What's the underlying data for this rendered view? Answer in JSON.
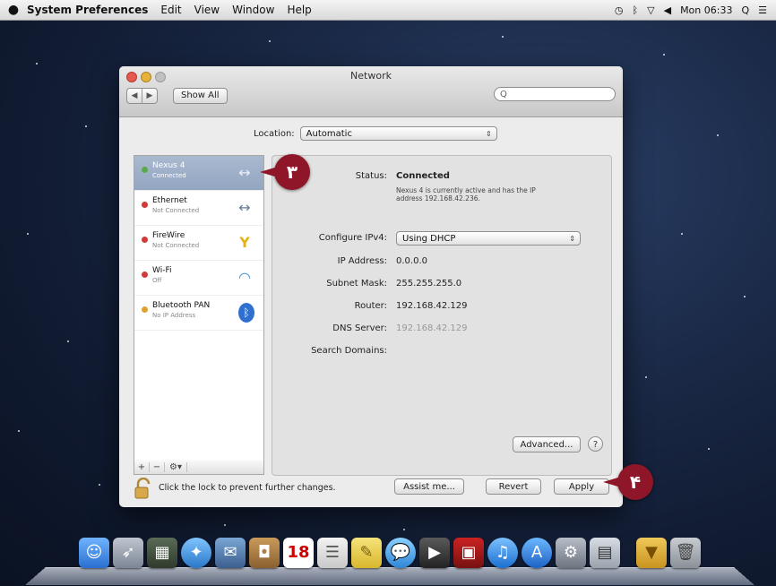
{
  "menubar": {
    "apple": "",
    "app_name": "System Preferences",
    "items": [
      "Edit",
      "View",
      "Window",
      "Help"
    ],
    "clock": "Mon 06:33"
  },
  "window": {
    "title": "Network",
    "nav_back": "◀",
    "nav_forward": "▶",
    "show_all": "Show All",
    "search_placeholder": "Q"
  },
  "location": {
    "label": "Location:",
    "value": "Automatic"
  },
  "services": [
    {
      "name": "Nexus 4",
      "status": "Connected",
      "dot": "#5aaa4a",
      "icon": "↔"
    },
    {
      "name": "Ethernet",
      "status": "Not Connected",
      "dot": "#d03a3a",
      "icon": "↔"
    },
    {
      "name": "FireWire",
      "status": "Not Connected",
      "dot": "#d03a3a",
      "icon": "Y"
    },
    {
      "name": "Wi-Fi",
      "status": "Off",
      "dot": "#d03a3a",
      "icon": "◠"
    },
    {
      "name": "Bluetooth PAN",
      "status": "No IP Address",
      "dot": "#e0a030",
      "icon": "ᛒ"
    }
  ],
  "sidebar_toolbar": {
    "add": "+",
    "remove": "−",
    "gear": "⚙▾"
  },
  "detail": {
    "status_label": "Status:",
    "status_value": "Connected",
    "status_desc_1": "Nexus 4 is currently active and has the IP",
    "status_desc_2": "address 192.168.42.236.",
    "configure_label": "Configure IPv4:",
    "configure_value": "Using DHCP",
    "ip_label": "IP Address:",
    "ip_value": "0.0.0.0",
    "subnet_label": "Subnet Mask:",
    "subnet_value": "255.255.255.0",
    "router_label": "Router:",
    "router_value": "192.168.42.129",
    "dns_label": "DNS Server:",
    "dns_value": "192.168.42.129",
    "search_domains_label": "Search Domains:",
    "advanced": "Advanced...",
    "help": "?"
  },
  "footer": {
    "lock_text": "Click the lock to prevent further changes.",
    "assist": "Assist me...",
    "revert": "Revert",
    "apply": "Apply"
  },
  "callouts": {
    "first": "۳",
    "second": "۴"
  },
  "colors": {
    "selected_row": "#9fb1ca",
    "callout": "#8e1628"
  },
  "dock": {
    "calendar_day": "18"
  }
}
